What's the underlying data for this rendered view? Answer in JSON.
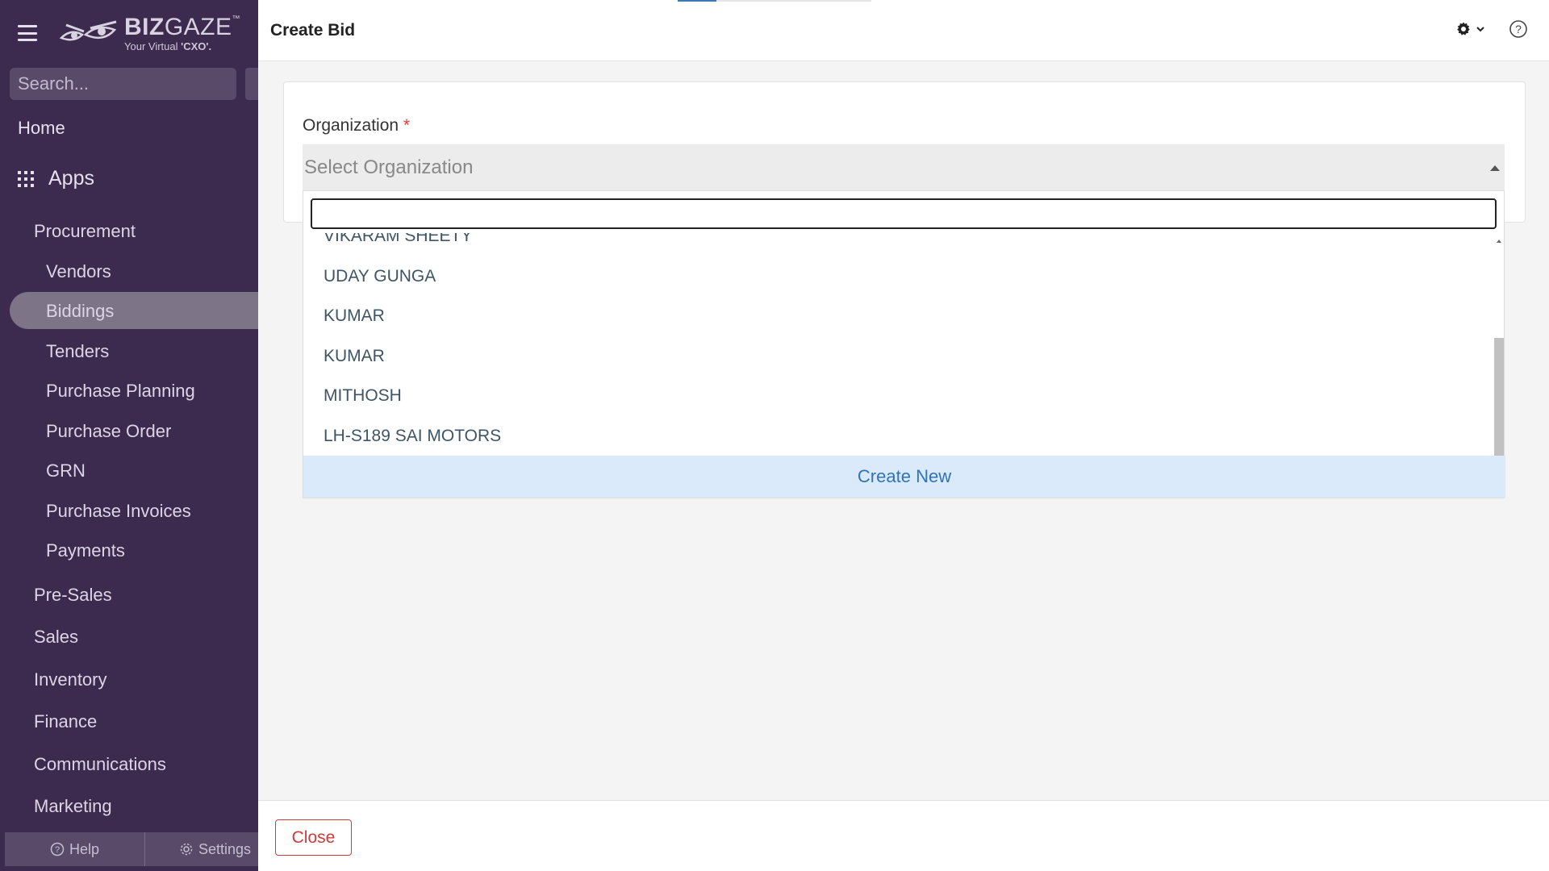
{
  "sidebar": {
    "logo": {
      "main_light": "BIZ",
      "main_rest": "GAZE",
      "tm": "™",
      "sub_prefix": "Your Virtual ",
      "sub_bold": "'CXO'."
    },
    "search": {
      "placeholder": "Search..."
    },
    "home": "Home",
    "apps": "Apps",
    "items": [
      {
        "label": "Procurement",
        "level": 1
      },
      {
        "label": "Vendors",
        "level": 2
      },
      {
        "label": "Biddings",
        "level": 2,
        "active": true
      },
      {
        "label": "Tenders",
        "level": 2
      },
      {
        "label": "Purchase Planning",
        "level": 2
      },
      {
        "label": "Purchase Order",
        "level": 2
      },
      {
        "label": "GRN",
        "level": 2
      },
      {
        "label": "Purchase Invoices",
        "level": 2
      },
      {
        "label": "Payments",
        "level": 2
      },
      {
        "label": "Pre-Sales",
        "level": 1
      },
      {
        "label": "Sales",
        "level": 1
      },
      {
        "label": "Inventory",
        "level": 1
      },
      {
        "label": "Finance",
        "level": 1
      },
      {
        "label": "Communications",
        "level": 1
      },
      {
        "label": "Marketing",
        "level": 1
      }
    ],
    "footer": {
      "help": "Help",
      "settings": "Settings"
    }
  },
  "header": {
    "title": "Create Bid"
  },
  "form": {
    "organization_label": "Organization",
    "required_marker": "*",
    "select_placeholder": "Select Organization",
    "search_value": ""
  },
  "dropdown": {
    "options": [
      "VIKARAM SHEETY",
      "UDAY GUNGA",
      "KUMAR",
      "KUMAR",
      "MITHOSH",
      "LH-S189 SAI MOTORS"
    ],
    "create_new": "Create New"
  },
  "footer": {
    "close": "Close"
  },
  "colors": {
    "sidebar_bg": "#3d2b4f",
    "active_item": "#7d7487",
    "accent": "#2f74b8",
    "danger": "#d03a3a"
  }
}
